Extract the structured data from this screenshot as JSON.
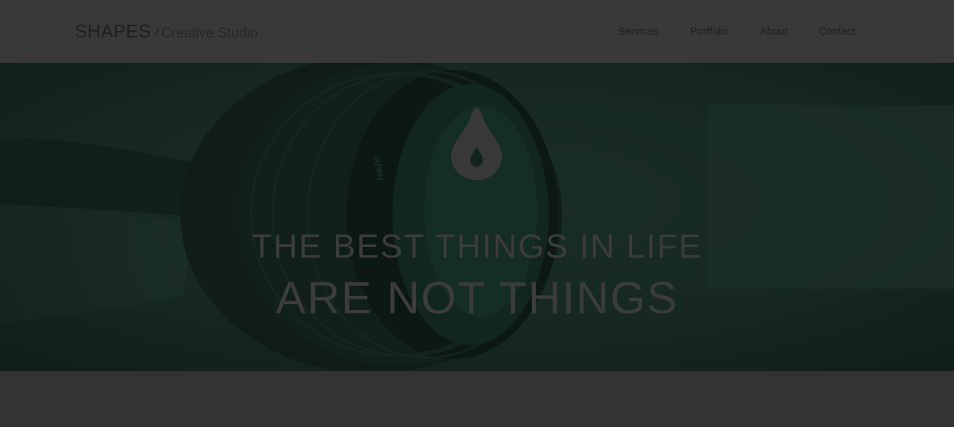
{
  "header": {
    "brand_name": "SHAPES",
    "brand_separator": "/",
    "brand_tagline": "Creative Studio",
    "nav": [
      {
        "label": "Services"
      },
      {
        "label": "Portfolio"
      },
      {
        "label": "About"
      },
      {
        "label": "Contact"
      }
    ]
  },
  "hero": {
    "icon": "water-drop-icon",
    "line1": "THE BEST THINGS IN LIFE",
    "line2": "ARE NOT THINGS",
    "overlay_color": "#13241f"
  },
  "colors": {
    "page_background": "#333333",
    "header_background": "#3a3a3a",
    "hero_text": "#3d3d3d"
  }
}
